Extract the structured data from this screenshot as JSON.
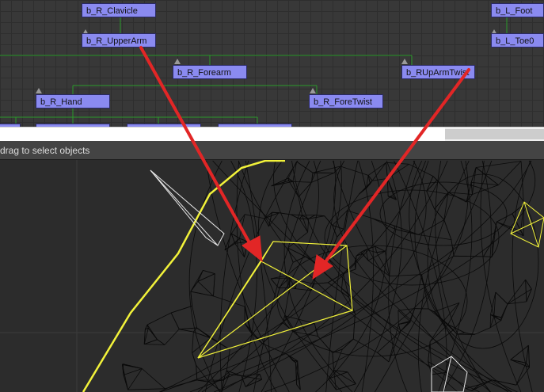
{
  "schematic": {
    "nodes": [
      {
        "id": "clavicle",
        "label": "b_R_Clavicle"
      },
      {
        "id": "upperarm",
        "label": "b_R_UpperArm"
      },
      {
        "id": "forearm",
        "label": "b_R_Forearm"
      },
      {
        "id": "ruparmtwist",
        "label": "b_RUpArmTwist"
      },
      {
        "id": "hand",
        "label": "b_R_Hand"
      },
      {
        "id": "foretwist",
        "label": "b_R_ForeTwist"
      },
      {
        "id": "lfoot",
        "label": "b_L_Foot"
      },
      {
        "id": "ltoe",
        "label": "b_L_Toe0"
      },
      {
        "id": "finger1",
        "label": ""
      },
      {
        "id": "finger2",
        "label": ""
      },
      {
        "id": "finger3",
        "label": ""
      },
      {
        "id": "finger4",
        "label": ""
      }
    ],
    "wire_color": "#2a9a2a",
    "node_color": "#8a8af0"
  },
  "status_bar": {
    "prompt": "drag to select objects"
  },
  "annotation": {
    "arrow_color": "#e22626"
  },
  "viewport": {
    "selection_color": "#f2f23a",
    "wire_color": "#0a0a0a"
  }
}
